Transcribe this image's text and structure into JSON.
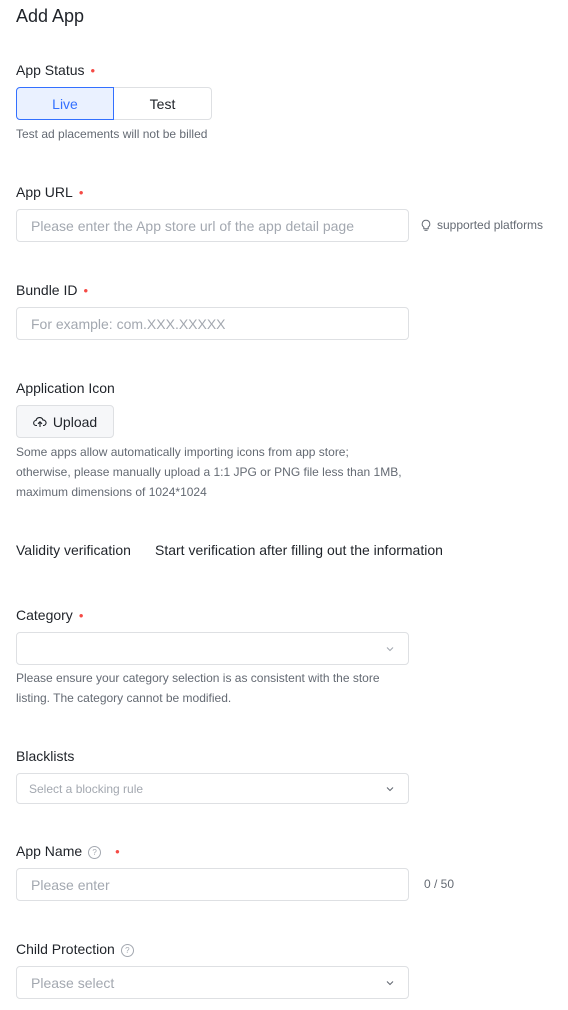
{
  "page": {
    "title": "Add App"
  },
  "app_status": {
    "label": "App Status",
    "required_mark": "•",
    "options": [
      "Live",
      "Test"
    ],
    "selected": "Live",
    "help": "Test ad placements will not be billed"
  },
  "app_url": {
    "label": "App URL",
    "required_mark": "•",
    "placeholder": "Please enter the App store url of the app detail page",
    "supported_link": "supported platforms"
  },
  "bundle_id": {
    "label": "Bundle ID",
    "required_mark": "•",
    "placeholder": "For example: com.XXX.XXXXX"
  },
  "app_icon": {
    "label": "Application Icon",
    "upload_label": "Upload",
    "help_lines": [
      "Some apps allow automatically importing icons from app store;",
      "otherwise, please manually upload a 1:1 JPG or PNG file less than 1MB,",
      "maximum dimensions of 1024*1024"
    ]
  },
  "validity": {
    "label": "Validity verification",
    "value": "Start verification after filling out the information"
  },
  "category": {
    "label": "Category",
    "required_mark": "•",
    "value": "",
    "help_lines": [
      "Please ensure your category selection is as consistent with the store",
      "listing. The category cannot be modified."
    ]
  },
  "blacklists": {
    "label": "Blacklists",
    "placeholder": "Select a blocking rule"
  },
  "app_name": {
    "label": "App Name",
    "required_mark": "•",
    "placeholder": "Please enter",
    "counter": "0 / 50"
  },
  "child_protection": {
    "label": "Child Protection",
    "placeholder": "Please select"
  },
  "colors": {
    "accent": "#3370ff",
    "required": "#f54a45",
    "border": "#dee0e3"
  }
}
